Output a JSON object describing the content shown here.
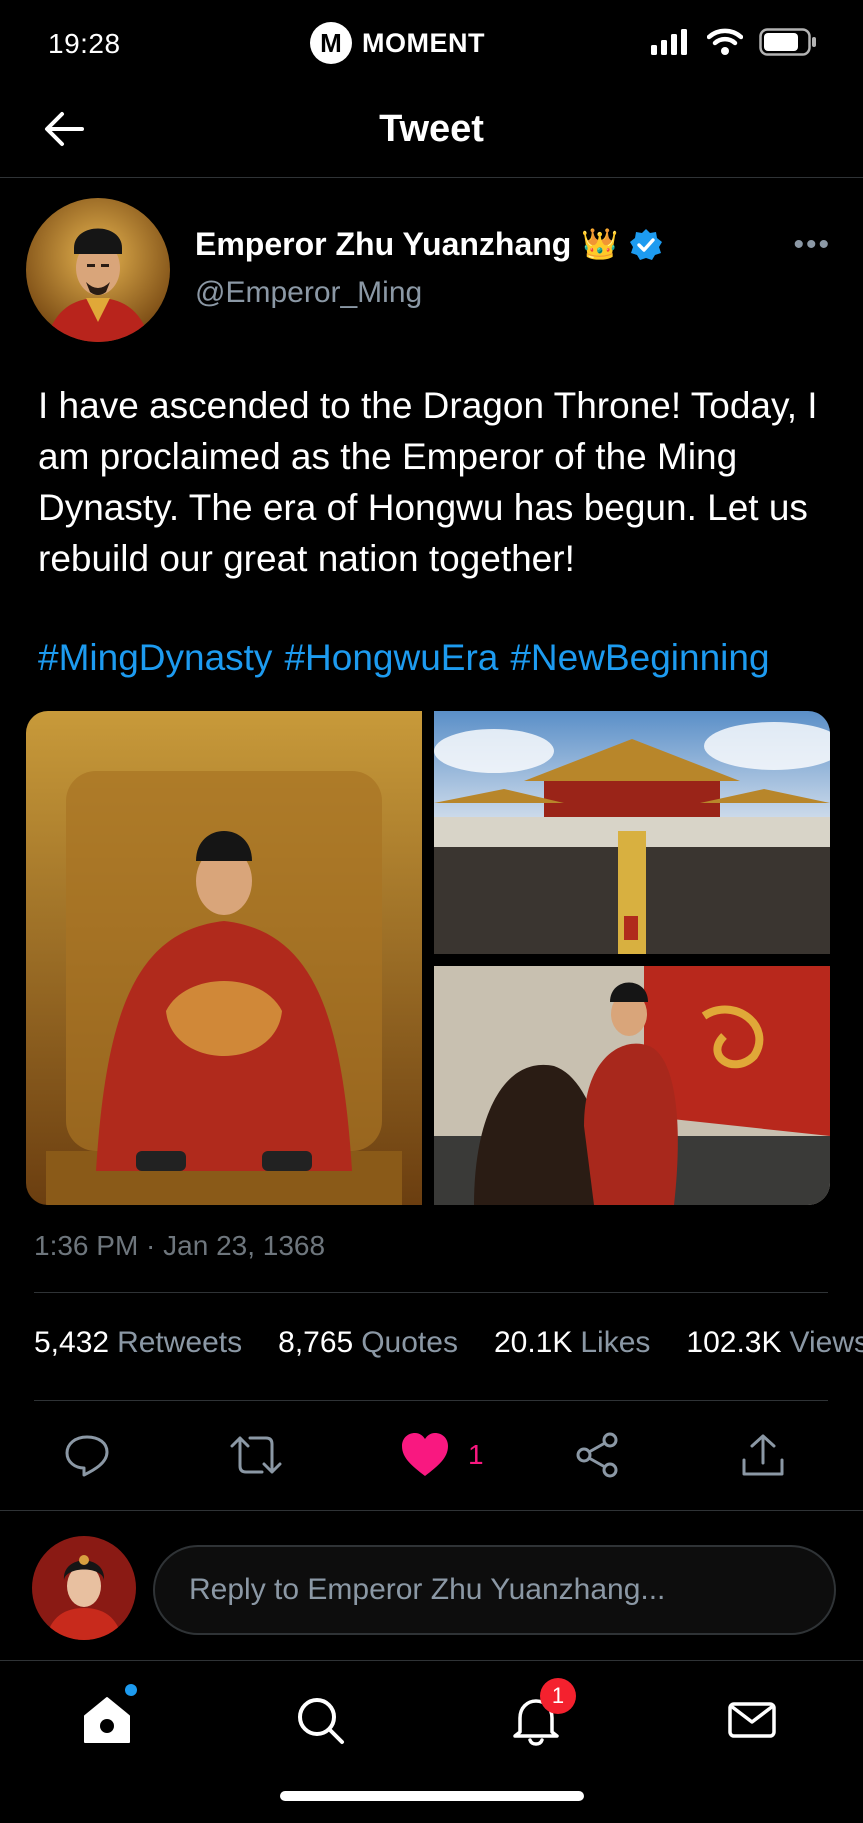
{
  "status_bar": {
    "time": "19:28",
    "brand_logo": "M",
    "brand_name": "MOMENT"
  },
  "header": {
    "title": "Tweet"
  },
  "author": {
    "name": "Emperor Zhu Yuanzhang",
    "emoji": "👑",
    "handle": "@Emperor_Ming",
    "verified": true
  },
  "tweet": {
    "text": "I have ascended to the Dragon Throne! Today, I am proclaimed as the Emperor of the Ming Dynasty. The era of Hongwu has begun. Let us rebuild our great nation together!",
    "hashtags": [
      "#MingDynasty",
      "#HongwuEra",
      "#NewBeginning"
    ],
    "timestamp": "1:36 PM · Jan 23, 1368"
  },
  "stats": [
    {
      "value": "5,432",
      "label": "Retweets"
    },
    {
      "value": "8,765",
      "label": "Quotes"
    },
    {
      "value": "20.1K",
      "label": "Likes"
    },
    {
      "value": "102.3K",
      "label": "Views"
    }
  ],
  "actions": {
    "like_count": "1"
  },
  "reply": {
    "placeholder": "Reply to Emperor Zhu Yuanzhang..."
  },
  "tabbar": {
    "notifications_badge": "1"
  },
  "colors": {
    "accent": "#1d9bf0",
    "like": "#f91880",
    "badge": "#f4212e",
    "muted": "#8b98a5"
  }
}
